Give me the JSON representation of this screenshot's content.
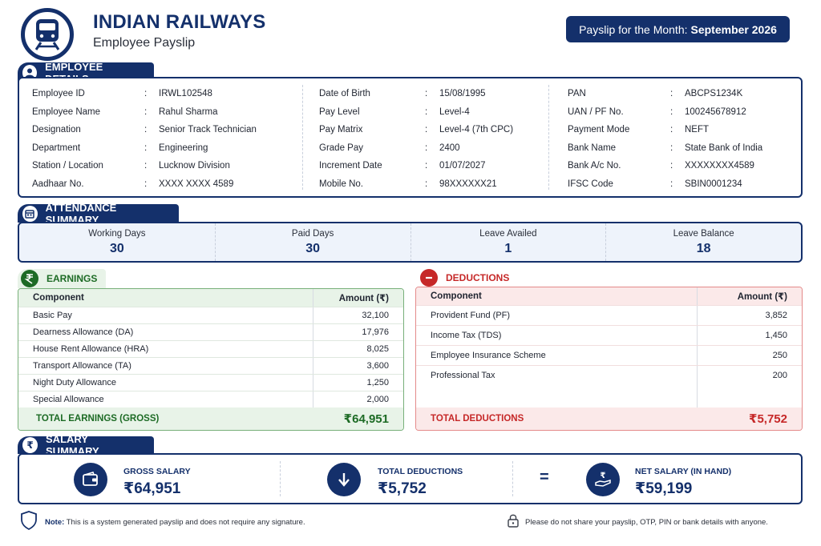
{
  "header": {
    "org_title": "INDIAN RAILWAYS",
    "doc_subtitle": "Employee Payslip",
    "month_label": "Payslip for the Month:",
    "month_value": "September 2026"
  },
  "employee_details": {
    "section_title": "EMPLOYEE DETAILS",
    "columns": [
      [
        {
          "label": "Employee ID",
          "value": "IRWL102548"
        },
        {
          "label": "Employee Name",
          "value": "Rahul Sharma"
        },
        {
          "label": "Designation",
          "value": "Senior Track Technician"
        },
        {
          "label": "Department",
          "value": "Engineering"
        },
        {
          "label": "Station / Location",
          "value": "Lucknow Division"
        },
        {
          "label": "Aadhaar No.",
          "value": "XXXX XXXX 4589"
        }
      ],
      [
        {
          "label": "Date of Birth",
          "value": "15/08/1995"
        },
        {
          "label": "Pay Level",
          "value": "Level-4"
        },
        {
          "label": "Pay Matrix",
          "value": "Level-4 (7th CPC)"
        },
        {
          "label": "Grade Pay",
          "value": "2400"
        },
        {
          "label": "Increment Date",
          "value": "01/07/2027"
        },
        {
          "label": "Mobile No.",
          "value": "98XXXXXX21"
        }
      ],
      [
        {
          "label": "PAN",
          "value": "ABCPS1234K"
        },
        {
          "label": "UAN / PF No.",
          "value": "100245678912"
        },
        {
          "label": "Payment Mode",
          "value": "NEFT"
        },
        {
          "label": "Bank Name",
          "value": "State Bank of India"
        },
        {
          "label": "Bank A/c No.",
          "value": "XXXXXXXX4589"
        },
        {
          "label": "IFSC Code",
          "value": "SBIN0001234"
        }
      ]
    ]
  },
  "attendance": {
    "section_title": "ATTENDANCE SUMMARY",
    "items": [
      {
        "label": "Working Days",
        "value": "30"
      },
      {
        "label": "Paid Days",
        "value": "30"
      },
      {
        "label": "Leave Availed",
        "value": "1"
      },
      {
        "label": "Leave Balance",
        "value": "18"
      }
    ]
  },
  "earnings": {
    "section_title": "EARNINGS",
    "col_component": "Component",
    "col_amount": "Amount (₹)",
    "rows": [
      {
        "component": "Basic Pay",
        "amount": "32,100"
      },
      {
        "component": "Dearness Allowance (DA)",
        "amount": "17,976"
      },
      {
        "component": "House Rent Allowance (HRA)",
        "amount": "8,025"
      },
      {
        "component": "Transport Allowance (TA)",
        "amount": "3,600"
      },
      {
        "component": "Night Duty Allowance",
        "amount": "1,250"
      },
      {
        "component": "Special Allowance",
        "amount": "2,000"
      }
    ],
    "total_label": "TOTAL EARNINGS (GROSS)",
    "total_value": "₹64,951"
  },
  "deductions": {
    "section_title": "DEDUCTIONS",
    "col_component": "Component",
    "col_amount": "Amount (₹)",
    "rows": [
      {
        "component": "Provident Fund (PF)",
        "amount": "3,852"
      },
      {
        "component": "Income Tax (TDS)",
        "amount": "1,450"
      },
      {
        "component": "Employee Insurance Scheme",
        "amount": "250"
      },
      {
        "component": "Professional Tax",
        "amount": "200"
      }
    ],
    "total_label": "TOTAL  DEDUCTIONS",
    "total_value": "₹5,752"
  },
  "salary_summary": {
    "section_title": "SALARY SUMMARY",
    "gross_label": "GROSS SALARY",
    "gross_value": "₹64,951",
    "ded_label": "TOTAL DEDUCTIONS",
    "ded_value": "₹5,752",
    "equals": "=",
    "net_label": "NET SALARY (IN HAND)",
    "net_value": "₹59,199"
  },
  "footer": {
    "note_label": "Note:",
    "note_text": "This is a system generated payslip and does not require any signature.",
    "warning_text": "Please do not share your payslip, OTP, PIN or bank details with anyone."
  },
  "colors": {
    "navy": "#14306b",
    "green": "#1d6b25",
    "red": "#c62828"
  }
}
